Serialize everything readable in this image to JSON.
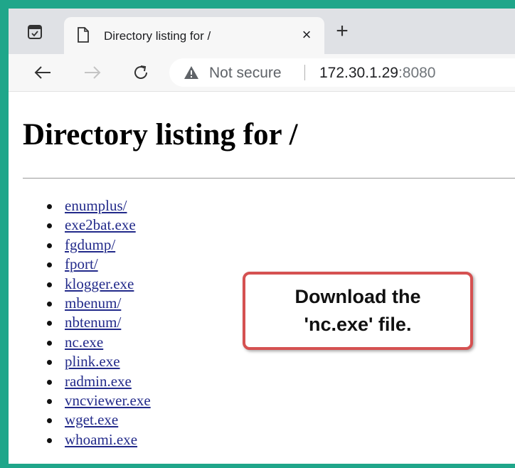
{
  "browser": {
    "tab": {
      "title": "Directory listing for /",
      "close_label": "×"
    },
    "new_tab_label": "+",
    "address_bar": {
      "security_label": "Not secure",
      "host": "172.30.1.29",
      "port": ":8080"
    }
  },
  "page": {
    "heading": "Directory listing for /",
    "files": [
      "enumplus/",
      "exe2bat.exe",
      "fgdump/",
      "fport/",
      "klogger.exe",
      "mbenum/",
      "nbtenum/",
      "nc.exe",
      "plink.exe",
      "radmin.exe",
      "vncviewer.exe",
      "wget.exe",
      "whoami.exe"
    ]
  },
  "callout": {
    "line1": "Download the",
    "line2": "'nc.exe' file."
  },
  "colors": {
    "frame_border": "#1fa68a",
    "callout_border": "#d55151",
    "link": "#222a8a"
  }
}
